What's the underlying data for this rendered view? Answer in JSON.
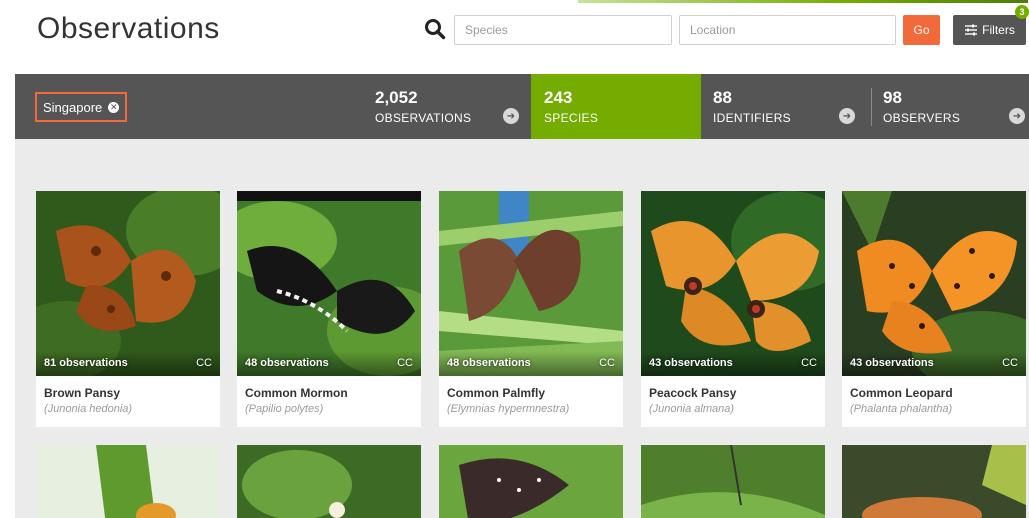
{
  "header": {
    "title": "Observations",
    "species_placeholder": "Species",
    "location_placeholder": "Location",
    "go_label": "Go",
    "filters_label": "Filters",
    "filters_count": "3"
  },
  "stats": {
    "place": "Singapore",
    "observations": {
      "value": "2,052",
      "label": "OBSERVATIONS"
    },
    "species": {
      "value": "243",
      "label": "SPECIES"
    },
    "identifiers": {
      "value": "88",
      "label": "IDENTIFIERS"
    },
    "observers": {
      "value": "98",
      "label": "OBSERVERS"
    }
  },
  "species_cards": [
    {
      "obs": "81 observations",
      "license": "CC",
      "common": "Brown Pansy",
      "scientific": "(Junonia hedonia)"
    },
    {
      "obs": "48 observations",
      "license": "CC",
      "common": "Common Mormon",
      "scientific": "(Papilio polytes)"
    },
    {
      "obs": "48 observations",
      "license": "CC",
      "common": "Common Palmfly",
      "scientific": "(Elymnias hypermnestra)"
    },
    {
      "obs": "43 observations",
      "license": "CC",
      "common": "Peacock Pansy",
      "scientific": "(Junonia almana)"
    },
    {
      "obs": "43 observations",
      "license": "CC",
      "common": "Common Leopard",
      "scientific": "(Phalanta phalantha)"
    }
  ],
  "colors": {
    "accent_green": "#74ac00",
    "accent_orange": "#f26a3c",
    "bar_gray": "#555555",
    "content_bg": "#ebebeb"
  },
  "icons": [
    "search-icon",
    "sliders-icon",
    "close-icon",
    "arrow-right-icon"
  ]
}
